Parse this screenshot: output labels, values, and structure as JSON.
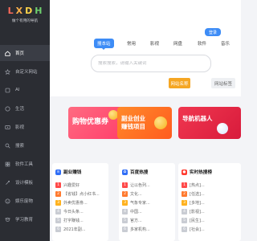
{
  "brand": {
    "logo_letters": [
      "L",
      "X",
      "D",
      "H"
    ],
    "tagline": "做个有用的导航"
  },
  "sidebar": {
    "items": [
      {
        "label": "首页",
        "icon": "home-icon",
        "active": true
      },
      {
        "label": "自定义网站",
        "icon": "star-icon"
      },
      {
        "label": "AI",
        "icon": "ai-icon"
      },
      {
        "label": "生活",
        "icon": "life-icon"
      },
      {
        "label": "影视",
        "icon": "video-icon"
      },
      {
        "label": "搜索",
        "icon": "search-icon"
      },
      {
        "label": "软件工具",
        "icon": "tool-icon"
      },
      {
        "label": "设计模板",
        "icon": "design-icon"
      },
      {
        "label": "娱乐废物",
        "icon": "fun-icon"
      },
      {
        "label": "学习教育",
        "icon": "study-icon"
      }
    ]
  },
  "header": {
    "login_label": "登录"
  },
  "search": {
    "tabs": [
      {
        "label": "搜本站",
        "active": true
      },
      {
        "label": "常用"
      },
      {
        "label": "影视"
      },
      {
        "label": "网盘"
      },
      {
        "label": "软件"
      },
      {
        "label": "音乐"
      }
    ],
    "placeholder": "搜索搜索，请输入关键词"
  },
  "ad_tabs": {
    "active": "网站名称",
    "inactive": "网站标签"
  },
  "banners": [
    {
      "text_line1": "购物优惠券",
      "text_line2": ""
    },
    {
      "text_line1": "副业创业",
      "text_line2": "赚钱项目"
    },
    {
      "text_line1": "导航机器人",
      "text_line2": ""
    }
  ],
  "cards": [
    {
      "title": "副业赚钱",
      "icon_color": "#2f6df6",
      "rows": [
        "兴趣爱好",
        "【省钱】点小红书...",
        "外卖优惠劵...",
        "今日头条...",
        "打字赚钱...",
        "2021年副..."
      ]
    },
    {
      "title": "百度热搜",
      "icon_color": "#2f6df6",
      "rows": [
        "让以色列...",
        "文化...",
        "气象专家...",
        "中国...",
        "官方...",
        "多家机构..."
      ]
    },
    {
      "title": "实时热搜榜",
      "icon_color": "#ff3b30",
      "rows": [
        "[热点]...",
        "[任选]...",
        "[多地]...",
        "[影视]...",
        "[民生]...",
        "[社会]..."
      ]
    }
  ]
}
